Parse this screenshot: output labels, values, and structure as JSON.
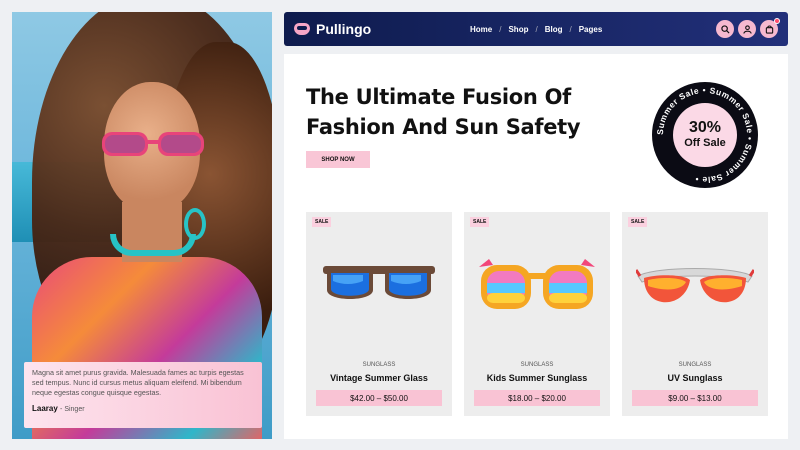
{
  "brand": {
    "name": "Pullingo"
  },
  "nav": {
    "items": [
      "Home",
      "Shop",
      "Blog",
      "Pages"
    ],
    "separator": "/",
    "icons": [
      "search-icon",
      "user-icon",
      "cart-icon"
    ]
  },
  "hero": {
    "headline_line1": "The Ultimate Fusion Of",
    "headline_line2": "Fashion And Sun Safety",
    "cta": "SHOP NOW"
  },
  "badge": {
    "ring_text": "Summer Sale • Summer Sale • Summer Sale •",
    "percent": "30%",
    "label": "Off Sale"
  },
  "testimonial": {
    "text": "Magna sit amet purus gravida. Malesuada fames ac turpis egestas sed tempus. Nunc id cursus metus aliquam eleifend. Mi bibendum neque egestas congue quisque egestas.",
    "author": "Laaray",
    "role": "Singer"
  },
  "products": [
    {
      "badge": "SALE",
      "category": "SUNGLASS",
      "name": "Vintage Summer Glass",
      "price": "$42.00 – $50.00"
    },
    {
      "badge": "SALE",
      "category": "SUNGLASS",
      "name": "Kids Summer Sunglass",
      "price": "$18.00 – $20.00"
    },
    {
      "badge": "SALE",
      "category": "SUNGLASS",
      "name": "UV Sunglass",
      "price": "$9.00 – $13.00"
    }
  ],
  "colors": {
    "nav": "#0e1b4d",
    "accent_pink": "#f9c6d6",
    "badge": "#0b0b14"
  }
}
